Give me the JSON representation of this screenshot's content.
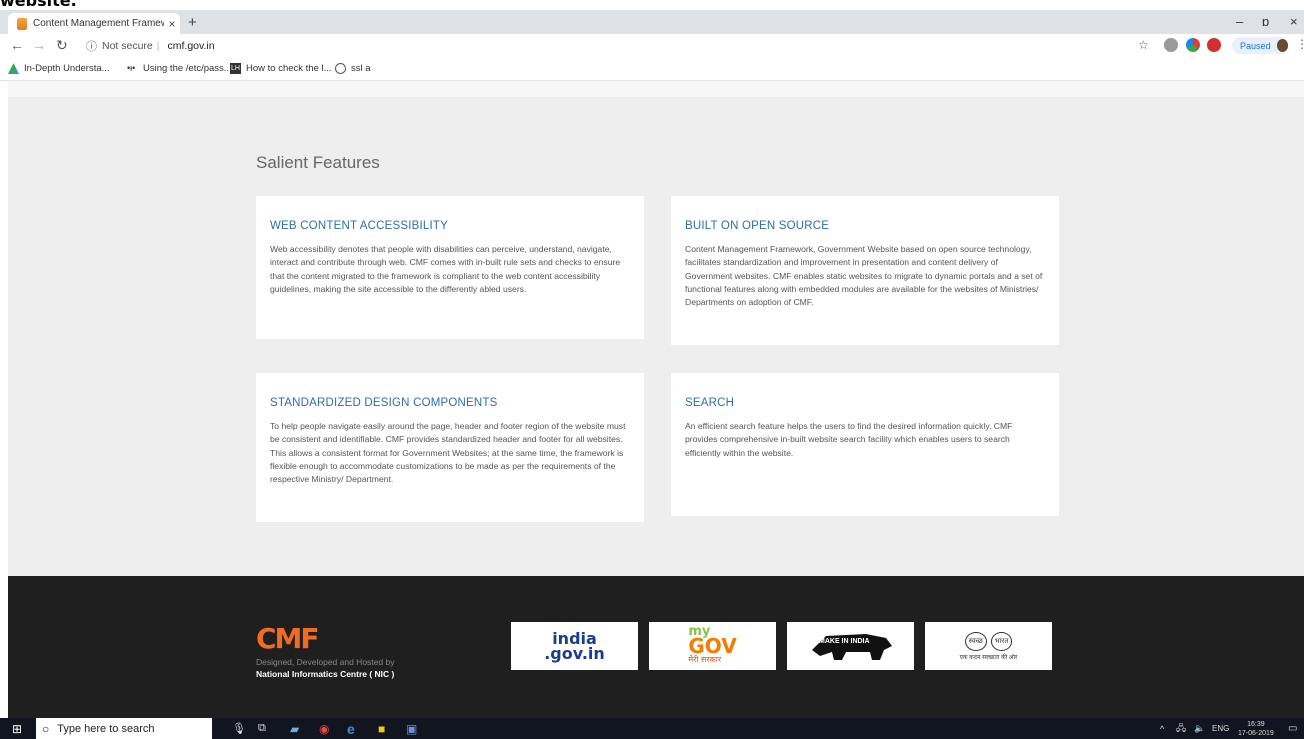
{
  "caption": "website.",
  "browser": {
    "tab_title": "Content Management Framewor",
    "tab_close": "×",
    "new_tab": "+",
    "security_text": "Not secure",
    "url": "cmf.gov.in",
    "paused_label": "Paused",
    "window_controls": {
      "minimize": "–",
      "restore": "ɒ",
      "close": "×"
    },
    "bookmarks": [
      {
        "label": "In-Depth Understa...",
        "icon": "drive-icon"
      },
      {
        "label": "Using the /etc/pass...",
        "icon": "link-icon"
      },
      {
        "label": "How to check the l...",
        "icon": "lh-icon"
      },
      {
        "label": "ssl a",
        "icon": "globe-icon"
      }
    ]
  },
  "page": {
    "section_title": "Salient Features",
    "features": [
      {
        "title": "WEB CONTENT ACCESSIBILITY",
        "text": "Web accessibility denotes that people with disabilities can perceive, understand, navigate, interact and contribute through web. CMF comes with in-built rule sets and checks to ensure that the content migrated to the framework is compliant to the web content accessibility guidelines, making the site accessible to the differently abled users."
      },
      {
        "title": "BUILT ON OPEN SOURCE",
        "text": "Content Management Framework, Government Website based on open source technology, facilitates standardization and improvement in presentation and content delivery of Government websites. CMF enables static websites to migrate to dynamic portals and a set of functional features along with embedded modules are available for the websites of Ministries/ Departments on adoption of CMF."
      },
      {
        "title": "STANDARDIZED DESIGN COMPONENTS",
        "text": "To help people navigate easily around the page, header and footer region of the website must be consistent and identifiable. CMF provides standardized header and footer for all websites. This allows a consistent format for Government Websites; at the same time, the framework is flexible enough to accommodate customizations to be made as per the requirements of the respective Ministry/ Department."
      },
      {
        "title": "SEARCH",
        "text": "An efficient search feature helps the users to find the desired information quickly. CMF provides comprehensive in-built website search facility which enables users to search efficiently within the website."
      }
    ]
  },
  "footer": {
    "logo_text": "CMF",
    "credit_line1": "Designed, Developed and Hosted by",
    "credit_line2": "National Informatics Centre ( NIC )",
    "partner_logos": {
      "india_top": "india",
      "india_bottom": ".gov.in",
      "mygov_top": "my",
      "mygov_main": "GOV",
      "mygov_sub": "मेरी सरकार",
      "makeinindia": "MAKE IN INDIA",
      "swachh_left": "स्वच्छ",
      "swachh_right": "भारत",
      "swachh_tagline": "एक कदम स्वच्छता की ओर"
    }
  },
  "taskbar": {
    "search_placeholder": "Type here to search",
    "language": "ENG",
    "time": "16:39",
    "date": "17-06-2019"
  },
  "colors": {
    "accent_blue": "#2f6ea5",
    "footer_bg": "#1f1f1f",
    "content_bg": "#eeeeee",
    "cmf_orange": "#f26b21"
  }
}
